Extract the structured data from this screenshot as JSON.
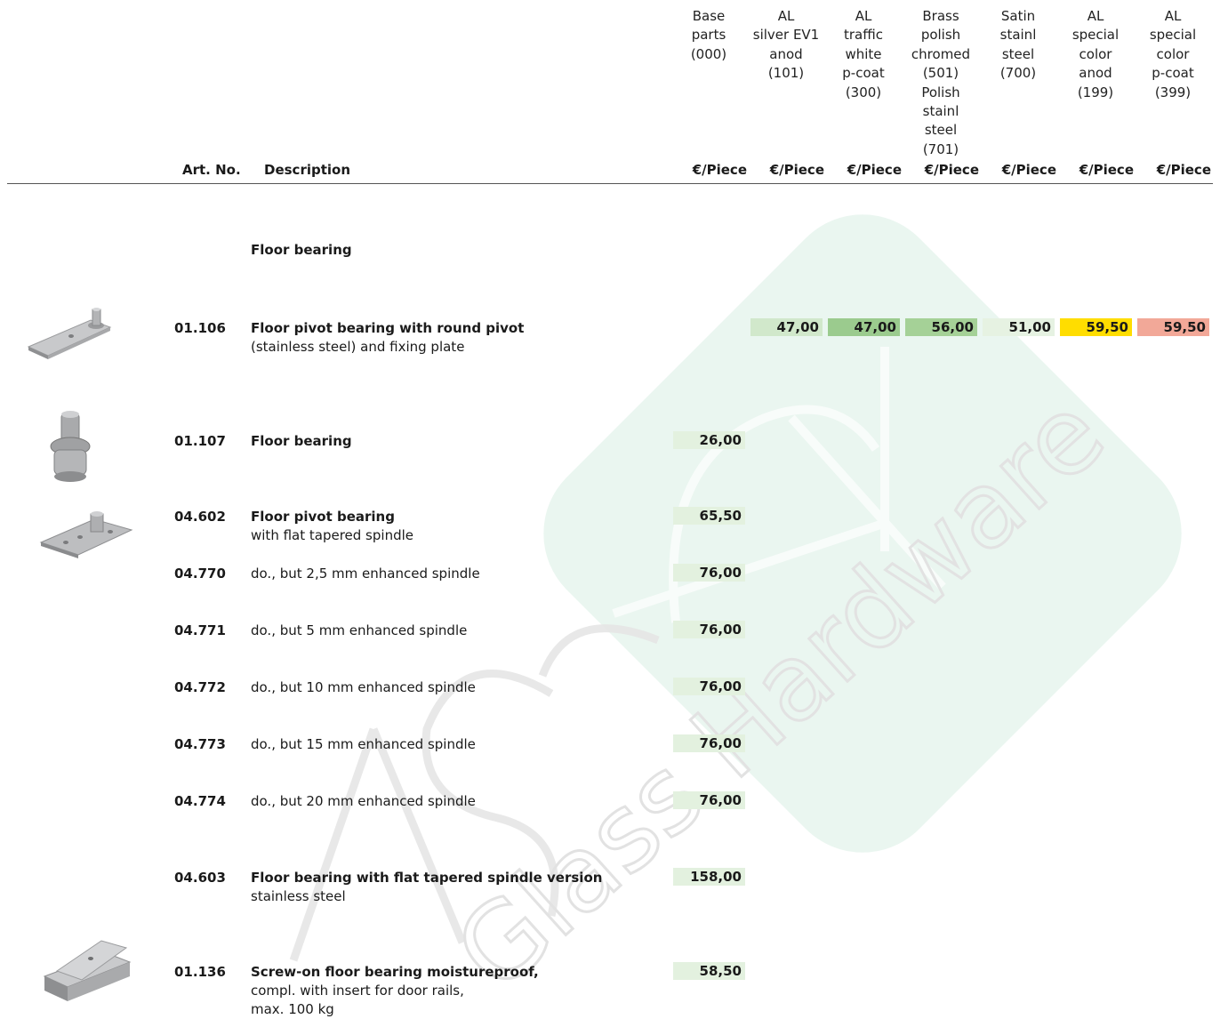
{
  "header": {
    "columns": [
      {
        "lines": [
          "Base",
          "parts",
          "(000)"
        ]
      },
      {
        "lines": [
          "AL",
          "silver EV1",
          "anod",
          "(101)"
        ]
      },
      {
        "lines": [
          "AL",
          "traffic",
          "white",
          "p-coat",
          "(300)"
        ]
      },
      {
        "lines": [
          "Brass",
          "polish",
          "chromed",
          "(501)",
          "Polish",
          "stainl",
          "steel",
          "(701)"
        ]
      },
      {
        "lines": [
          "Satin",
          "stainl",
          "steel",
          "(700)"
        ]
      },
      {
        "lines": [
          "AL",
          "special",
          "color",
          "anod",
          "(199)"
        ]
      },
      {
        "lines": [
          "AL",
          "special",
          "color",
          "p-coat",
          "(399)"
        ]
      }
    ],
    "art_no_label": "Art. No.",
    "description_label": "Description",
    "unit_label": "€/Piece"
  },
  "section_title": "Floor bearing",
  "colors": {
    "base": "#e3f1df",
    "al_silver": "#d1e8cb",
    "traffic_white": "#9bcb8e",
    "brass": "#a5d197",
    "satin": "#e6f2e2",
    "special_anod": "#ffdd00",
    "special_pcoat": "#f2a898"
  },
  "rows": [
    {
      "art": "01.106",
      "title": "Floor pivot bearing with round pivot",
      "lines": [
        "(stainless steel) and fixing plate"
      ],
      "prices": [
        "",
        "47,00",
        "47,00",
        "56,00",
        "51,00",
        "59,50",
        "59,50"
      ],
      "image": "pivot-bearing-plate"
    },
    {
      "art": "01.107",
      "title": "Floor bearing",
      "lines": [],
      "prices": [
        "26,00"
      ],
      "image": "floor-bearing-round"
    },
    {
      "art": "04.602",
      "title": "Floor pivot bearing",
      "lines": [
        "with flat tapered spindle"
      ],
      "prices": [
        "65,50"
      ],
      "image": "pivot-bearing-flat"
    },
    {
      "art": "04.770",
      "title": "",
      "lines": [
        "do., but 2,5 mm enhanced spindle"
      ],
      "prices": [
        "76,00"
      ]
    },
    {
      "art": "04.771",
      "title": "",
      "lines": [
        "do., but 5 mm enhanced spindle"
      ],
      "prices": [
        "76,00"
      ]
    },
    {
      "art": "04.772",
      "title": "",
      "lines": [
        "do., but 10 mm enhanced spindle"
      ],
      "prices": [
        "76,00"
      ]
    },
    {
      "art": "04.773",
      "title": "",
      "lines": [
        "do., but 15 mm enhanced spindle"
      ],
      "prices": [
        "76,00"
      ]
    },
    {
      "art": "04.774",
      "title": "",
      "lines": [
        "do., but 20 mm enhanced spindle"
      ],
      "prices": [
        "76,00"
      ]
    },
    {
      "art": "04.603",
      "title": "Floor bearing with flat tapered spindle version",
      "lines": [
        "stainless steel"
      ],
      "prices": [
        "158,00"
      ]
    },
    {
      "art": "01.136",
      "title": "Screw-on floor bearing moistureproof,",
      "lines": [
        "compl. with insert for door rails,",
        "max. 100 kg"
      ],
      "prices": [
        "58,50"
      ],
      "image": "screw-on-bearing"
    }
  ],
  "watermark": {
    "brand": "Glass Hardware"
  }
}
